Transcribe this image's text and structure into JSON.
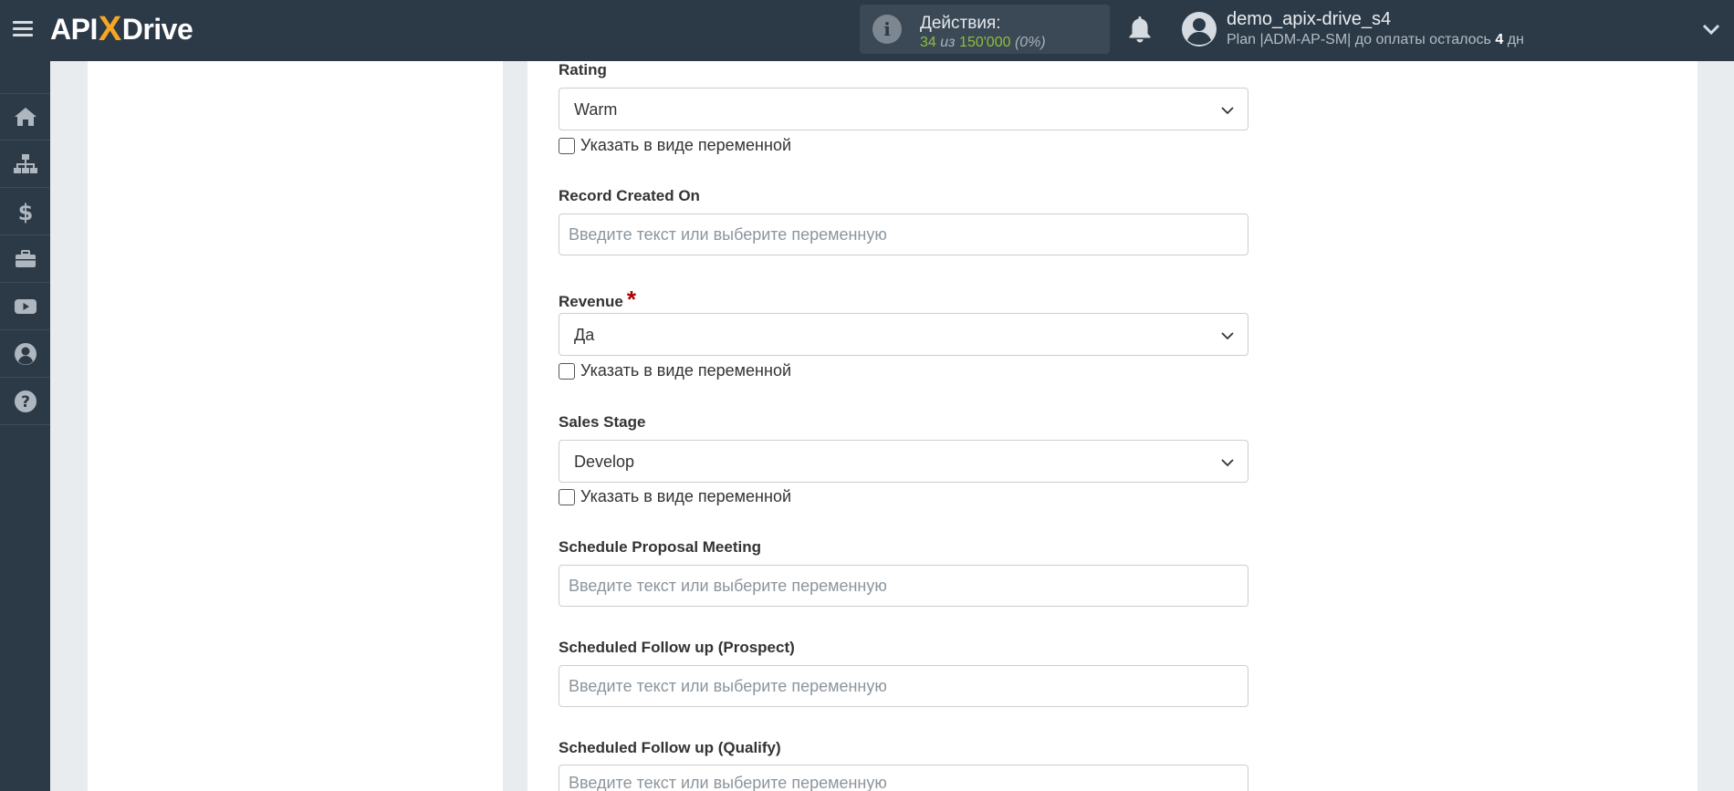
{
  "header": {
    "logo_left": "API",
    "logo_x": "X",
    "logo_right": "Drive",
    "actions_title": "Действия:",
    "actions_used": "34",
    "actions_of": "из",
    "actions_total": "150'000",
    "actions_pct": "(0%)",
    "user_name": "demo_apix-drive_s4",
    "plan_text": "Plan |ADM-AP-SM| до оплаты осталось",
    "days_left": "4",
    "days_unit": "дн"
  },
  "sidebar": {
    "items": [
      "home-icon",
      "sitemap-icon",
      "dollar-icon",
      "briefcase-icon",
      "youtube-icon",
      "user-circle-icon",
      "help-icon"
    ]
  },
  "form": {
    "variable_checkbox_label": "Указать в виде переменной",
    "input_placeholder": "Введите текст или выберите переменную",
    "rating_label": "Rating",
    "rating_value": "Warm",
    "record_created_label": "Record Created On",
    "revenue_label": "Revenue",
    "revenue_required": "*",
    "revenue_value": "Да",
    "sales_stage_label": "Sales Stage",
    "sales_stage_value": "Develop",
    "schedule_proposal_label": "Schedule Proposal Meeting",
    "followup_prospect_label": "Scheduled Follow up (Prospect)",
    "followup_qualify_label": "Scheduled Follow up (Qualify)"
  },
  "colors": {
    "topbar": "#2c3a47",
    "accent_green": "#8fbe3c",
    "logo_x": "#f5a623",
    "required": "#b40000"
  }
}
